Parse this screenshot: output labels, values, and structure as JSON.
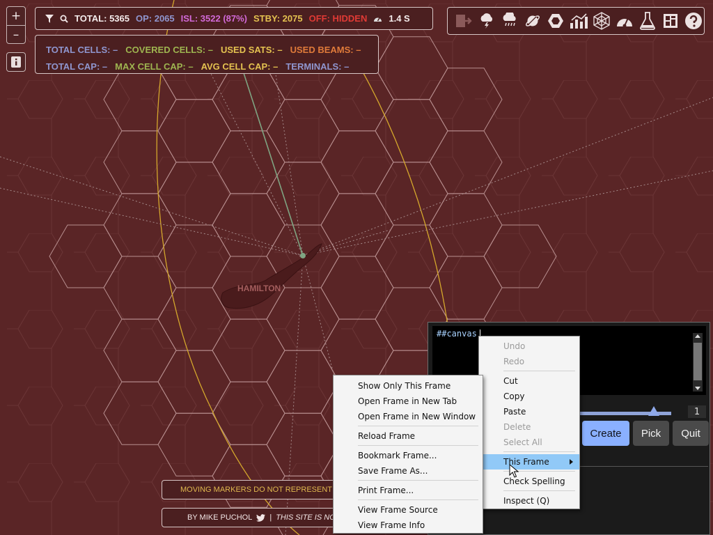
{
  "stats": {
    "total": "TOTAL: 5365",
    "op": "OP: 2065",
    "isl": "ISL: 3522 (87%)",
    "stby": "STBY: 2075",
    "off": "OFF: HIDDEN",
    "speed": "1.4 S"
  },
  "cells": {
    "total_cells": "TOTAL CELLS: –",
    "covered_cells": "COVERED CELLS: –",
    "used_sats": "USED SATS: –",
    "used_beams": "USED BEAMS: –",
    "total_cap": "TOTAL CAP: –",
    "max_cell_cap": "MAX CELL CAP: –",
    "avg_cell_cap": "AVG CELL CAP: –",
    "terminals": "TERMINALS: –"
  },
  "zoom": {
    "in": "+",
    "out": "–"
  },
  "map": {
    "city_label": "HAMILTON"
  },
  "footer": {
    "disclaimer": "MOVING MARKERS DO NOT REPRESENT A",
    "credits_by": "BY MIKE PUCHOL",
    "credits_sep": "|",
    "credits_site": "THIS SITE IS NO"
  },
  "devtools": {
    "console_text": "##canvas",
    "spinner_value": "1",
    "create_label": "Create",
    "pick_label": "Pick",
    "quit_label": "Quit"
  },
  "edit_menu": {
    "undo": "Undo",
    "redo": "Redo",
    "cut": "Cut",
    "copy": "Copy",
    "paste": "Paste",
    "delete": "Delete",
    "select_all": "Select All",
    "this_frame": "This Frame",
    "check_spelling": "Check Spelling",
    "inspect": "Inspect (Q)"
  },
  "frame_menu": {
    "show_only": "Show Only This Frame",
    "open_tab": "Open Frame in New Tab",
    "open_window": "Open Frame in New Window",
    "reload": "Reload Frame",
    "bookmark": "Bookmark Frame...",
    "save_as": "Save Frame As...",
    "print": "Print Frame...",
    "view_source": "View Frame Source",
    "view_info": "View Frame Info"
  },
  "colors": {
    "background": "#5a2526",
    "op": "#8f96cf",
    "isl": "#d26ad8",
    "stby": "#e4c250",
    "off": "#e03a35",
    "covered": "#9eb550",
    "used_beams": "#e07b3a",
    "hex_line": "#c9a2a2",
    "orbit": "#d4a72c",
    "beam": "#7fa482"
  },
  "icons": [
    "filter-icon",
    "search-icon",
    "gauge-icon",
    "export-icon",
    "storm-icon",
    "rain-icon",
    "planet-icon",
    "hexagon-icon",
    "chart-icon",
    "network-icon",
    "speedometer-icon",
    "flask-icon",
    "layout-icon",
    "help-icon",
    "info-icon",
    "twitter-icon"
  ]
}
